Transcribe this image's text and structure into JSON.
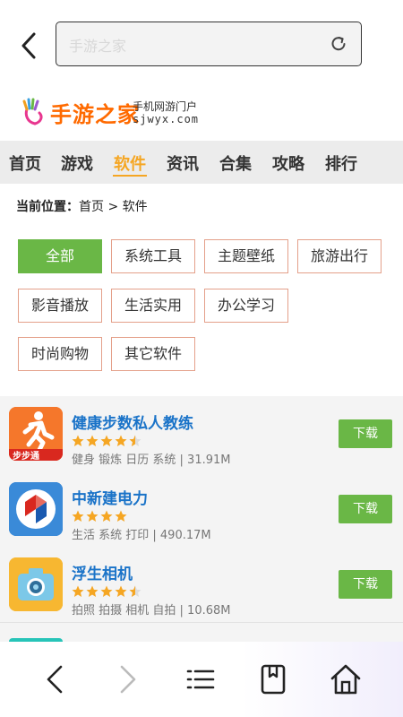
{
  "browser": {
    "url_text": "手游之家"
  },
  "logo": {
    "name": "手游之家",
    "sub1": "手机网游门户",
    "sub2": "sjwyx.com"
  },
  "nav": {
    "items": [
      {
        "label": "首页"
      },
      {
        "label": "游戏"
      },
      {
        "label": "软件",
        "active": true
      },
      {
        "label": "资讯"
      },
      {
        "label": "合集"
      },
      {
        "label": "攻略"
      },
      {
        "label": "排行"
      }
    ]
  },
  "breadcrumb": {
    "prefix": "当前位置：",
    "path": "首页 > 软件"
  },
  "categories": [
    {
      "label": "全部",
      "active": true
    },
    {
      "label": "系统工具"
    },
    {
      "label": "主题壁纸"
    },
    {
      "label": "旅游出行"
    },
    {
      "label": "影音播放"
    },
    {
      "label": "生活实用"
    },
    {
      "label": "办公学习"
    },
    {
      "label": "时尚购物"
    },
    {
      "label": "其它软件"
    }
  ],
  "apps": [
    {
      "name": "健康步数私人教练",
      "rating": 4.5,
      "meta": "健身 锻炼 日历 系统 | 31.91M",
      "download": "下载",
      "icon_text": "步步通"
    },
    {
      "name": "中新建电力",
      "rating": 4,
      "meta": "生活 系统 打印 | 490.17M",
      "download": "下载"
    },
    {
      "name": "浮生相机",
      "rating": 4.5,
      "meta": "拍照 拍摄 相机 自拍 | 10.68M",
      "download": "下载"
    }
  ],
  "colors": {
    "accent": "#f5a623",
    "green": "#6ab746",
    "link": "#1a73c8",
    "star": "#f5a623"
  }
}
